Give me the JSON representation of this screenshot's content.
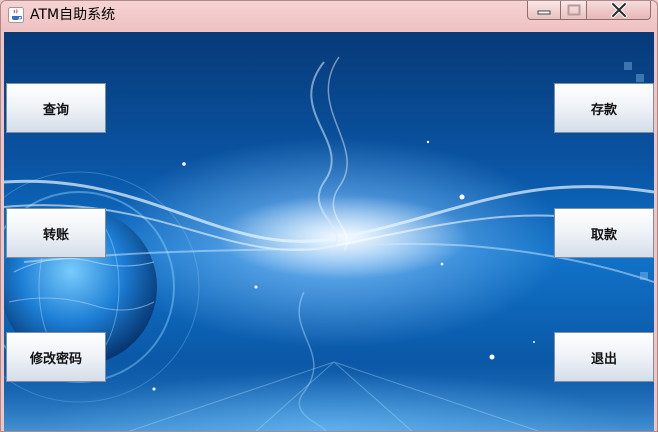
{
  "window": {
    "title": "ATM自助系统",
    "icons": [
      "java-cup-icon",
      "minimize-icon",
      "maximize-icon",
      "close-icon"
    ]
  },
  "buttons": {
    "query": "查询",
    "transfer": "转账",
    "change_password": "修改密码",
    "deposit": "存款",
    "withdraw": "取款",
    "exit": "退出"
  },
  "colors": {
    "background_dark": "#073a78",
    "background_mid": "#1173c9",
    "titlebar": "#f0c5c5"
  }
}
